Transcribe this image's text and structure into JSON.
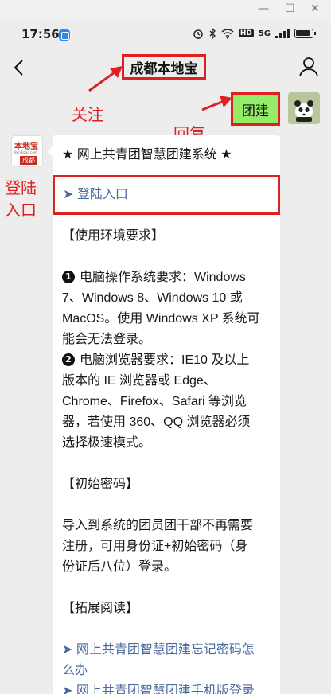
{
  "status_bar": {
    "time": "17:56",
    "icons": [
      "alarm-icon",
      "bluetooth-icon",
      "wifi-icon",
      "hd-icon",
      "signal-icon",
      "battery-icon"
    ],
    "hd_label": "HD",
    "signal_label": "5G"
  },
  "chrome": {
    "minimize": "—",
    "maximize": "☐",
    "close": "✕"
  },
  "nav": {
    "title": "成都本地宝"
  },
  "annotations": {
    "follow": "关注",
    "reply": "回复",
    "login_entry_line1": "登陆",
    "login_entry_line2": "入口"
  },
  "sent_message": {
    "text": "团建"
  },
  "bot_avatar": {
    "brand": "本地宝",
    "site": "Bendibao.com",
    "city": "成都"
  },
  "reply": {
    "header": "★ 网上共青团智慧团建系统 ★",
    "login_link": "➤ 登陆入口",
    "env_title": "【使用环境要求】",
    "os_num": "1",
    "os_lines": [
      "电脑操作系统要求：Windows",
      "7、Windows 8、Windows 10 或",
      "MacOS。使用 Windows XP 系统可",
      "能会无法登录。"
    ],
    "browser_num": "2",
    "browser_lines": [
      "电脑浏览器要求：IE10 及以上",
      "版本的 IE 浏览器或 Edge、",
      "Chrome、Firefox、Safari 等浏览",
      "器，若使用 360、QQ 浏览器必须",
      "选择极速模式。"
    ],
    "pwd_title": "【初始密码】",
    "pwd_lines": [
      "导入到系统的团员团干部不再需要",
      "注册，可用身份证+初始密码（身",
      "份证后八位）登录。"
    ],
    "ext_title": "【拓展阅读】",
    "ext_link1_line1": "➤ 网上共青团智慧团建忘记密码怎",
    "ext_link1_line2": "么办",
    "ext_link2": "➤ 网上共青团智慧团建手机版登录"
  }
}
